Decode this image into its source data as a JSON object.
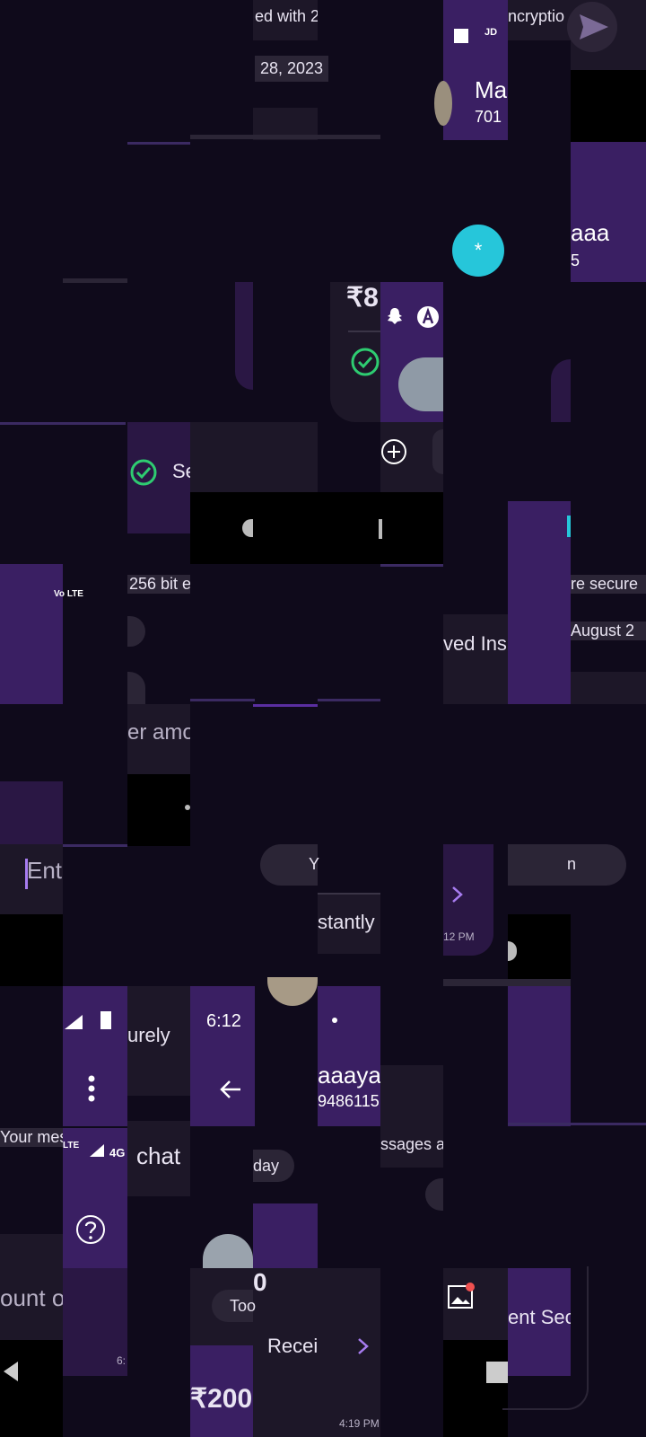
{
  "status": {
    "time_a": "6:12",
    "time_b": "6:",
    "network": "4G",
    "lte": "LTE",
    "volte": "Vo LTE",
    "jd": "JD"
  },
  "header": {
    "contact_name_a": "Ma",
    "contact_number_a": "701",
    "contact_name_b": "aaaya",
    "contact_number_b": "9486115",
    "contact_name_c": "aaa",
    "contact_number_c": "5"
  },
  "banners": {
    "secured_prefix": "ed with 2",
    "encryption_fragment": "ncryptio",
    "bit_fragment": "256 bit e",
    "secure_fragment": "re secure",
    "your_mes_fragment": "Your mes",
    "messages_fragment": "ssages ar",
    "secured_fragment": "urely"
  },
  "dates": {
    "date_a": "28, 2023",
    "date_b": "August 2",
    "today_a": "day",
    "today_b": "Too"
  },
  "payments": {
    "amount_a": "₹8",
    "amount_b": "₹200",
    "amount_c": "0",
    "received_label": "Recei",
    "received_ins": "ved Ins",
    "sent_secure": "ent Sec",
    "secure_label": "Se",
    "instantly": "stantly",
    "you_fragment": "Y",
    "n_fragment": "n",
    "time_a": "12 PM",
    "time_b": "4:19 PM"
  },
  "composer": {
    "enter_placeholder": "Ente",
    "enter_amount": "er amo",
    "amount_on": "ount or",
    "chat_label": "chat"
  },
  "fab": {
    "label": "*"
  },
  "colors": {
    "background": "#0f0a1b",
    "purple": "#3a1f63",
    "card": "#1d1728",
    "accent": "#26c6da",
    "green": "#2ecc71",
    "violet_icon": "#a77cf0"
  }
}
